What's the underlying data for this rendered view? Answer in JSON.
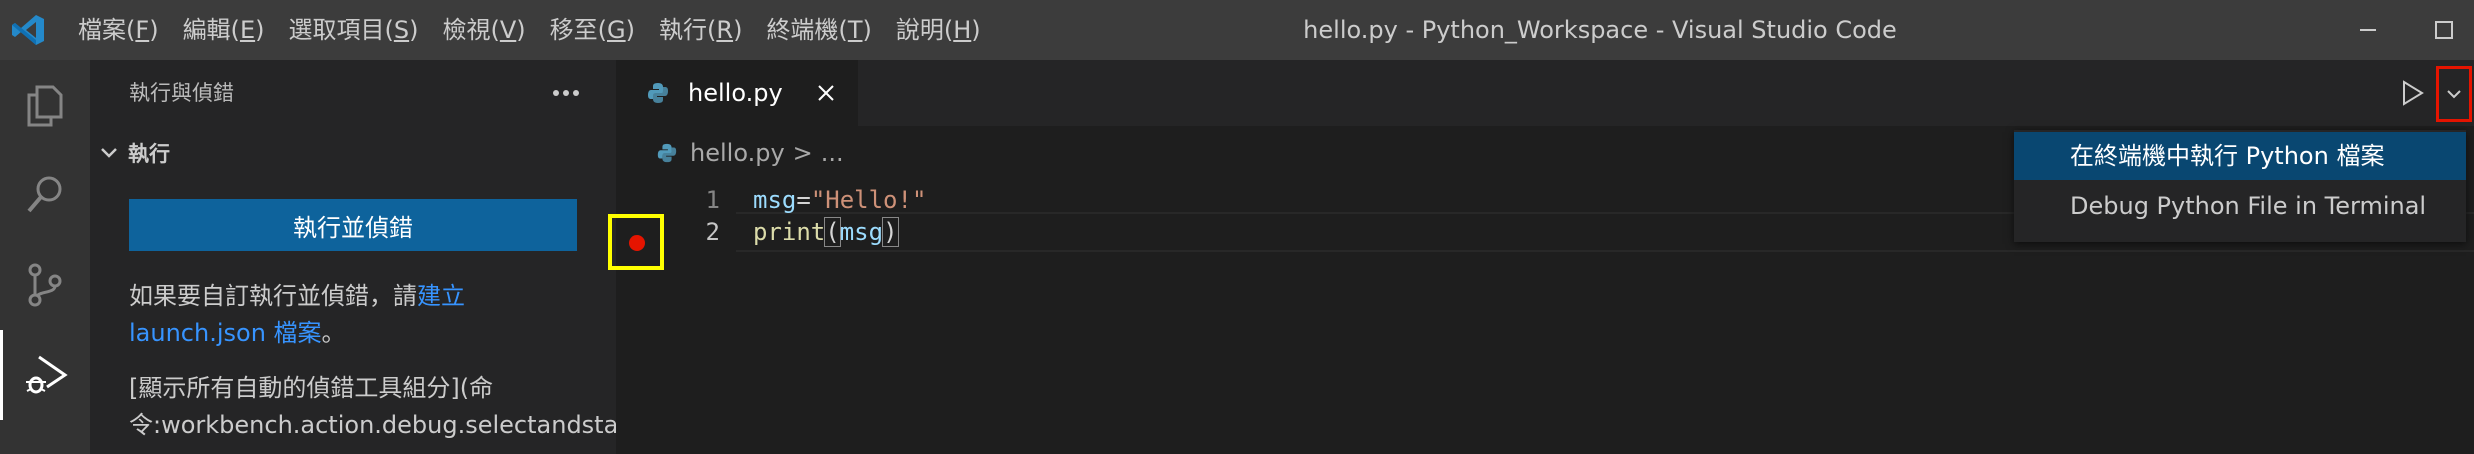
{
  "titlebar": {
    "menu": [
      {
        "label": "檔案(",
        "key": "F",
        "end": ")"
      },
      {
        "label": "編輯(",
        "key": "E",
        "end": ")"
      },
      {
        "label": "選取項目(",
        "key": "S",
        "end": ")"
      },
      {
        "label": "檢視(",
        "key": "V",
        "end": ")"
      },
      {
        "label": "移至(",
        "key": "G",
        "end": ")"
      },
      {
        "label": "執行(",
        "key": "R",
        "end": ")"
      },
      {
        "label": "終端機(",
        "key": "T",
        "end": ")"
      },
      {
        "label": "說明(",
        "key": "H",
        "end": ")"
      }
    ],
    "window_title": "hello.py - Python_Workspace - Visual Studio Code"
  },
  "sidebar": {
    "header": "執行與偵錯",
    "section": "執行",
    "run_button": "執行並偵錯",
    "help_text_prefix": "如果要自訂執行並偵錯，請",
    "help_link": "建立 launch.json 檔案",
    "help_text_suffix": "。",
    "debugger_line1": "[顯示所有自動的偵錯工具組分](命",
    "debugger_line2": "令:workbench.action.debug.selectandstart)"
  },
  "editor": {
    "tab_label": "hello.py",
    "breadcrumb_file": "hello.py",
    "breadcrumb_sep": ">",
    "breadcrumb_more": "...",
    "lines": [
      {
        "number": "1",
        "var": "msg",
        "op": "=",
        "str": "\"Hello!\""
      },
      {
        "number": "2",
        "fn": "print",
        "open": "(",
        "arg": "msg",
        "close": ")"
      }
    ]
  },
  "run_menu": {
    "items": [
      "在終端機中執行 Python 檔案",
      "Debug Python File in Terminal"
    ]
  },
  "colors": {
    "accent": "#0e639c",
    "breakpoint": "#e51400",
    "highlight_box": "#ffff00",
    "menu_selected": "#094771"
  }
}
